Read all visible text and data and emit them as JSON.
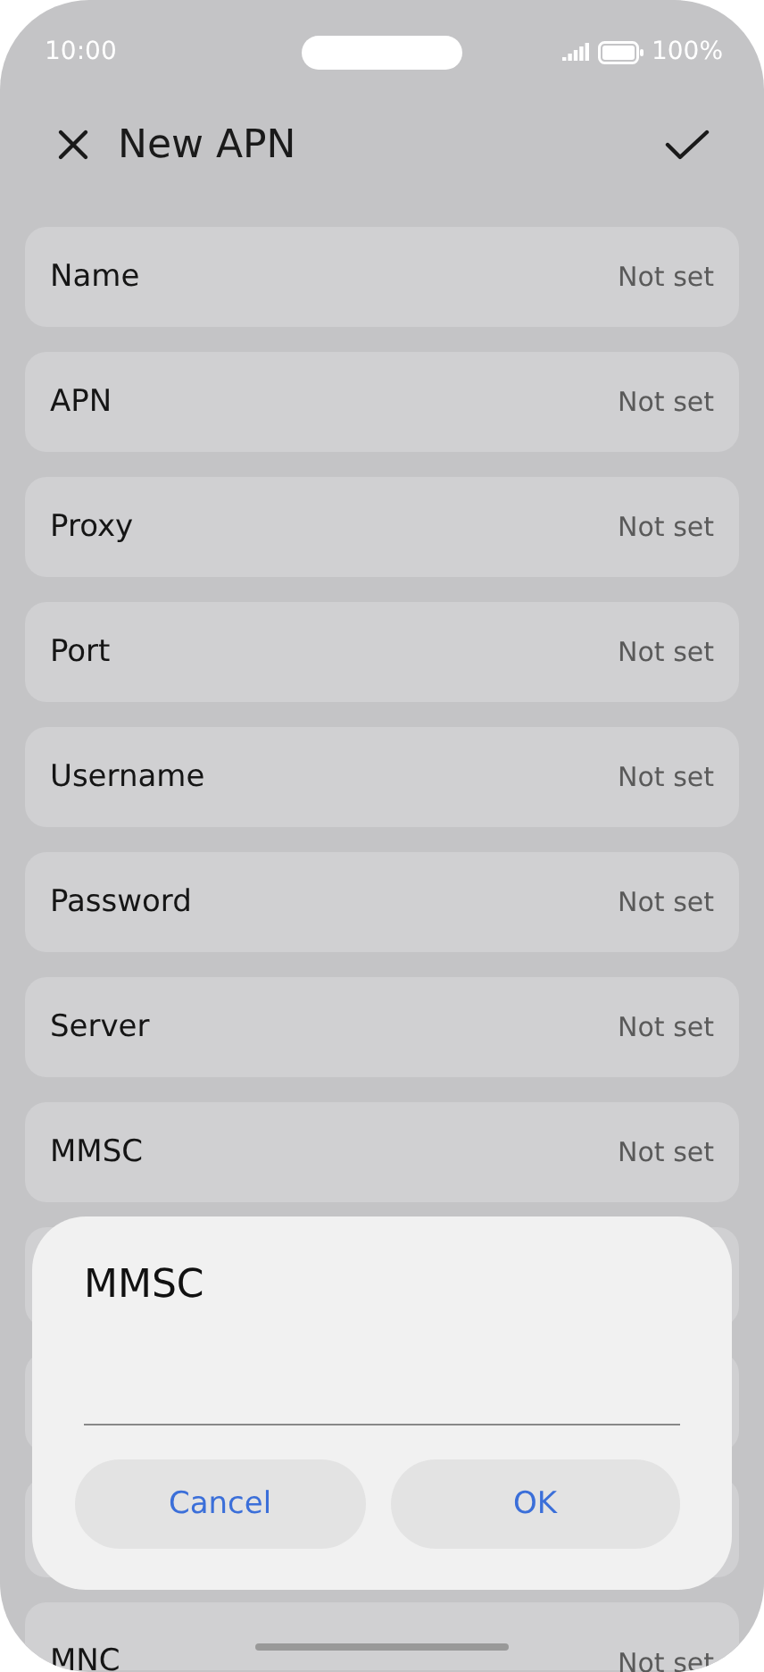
{
  "status_bar": {
    "time": "10:00",
    "battery": "100%"
  },
  "header": {
    "title": "New APN"
  },
  "fields": [
    {
      "label": "Name",
      "value": "Not set"
    },
    {
      "label": "APN",
      "value": "Not set"
    },
    {
      "label": "Proxy",
      "value": "Not set"
    },
    {
      "label": "Port",
      "value": "Not set"
    },
    {
      "label": "Username",
      "value": "Not set"
    },
    {
      "label": "Password",
      "value": "Not set"
    },
    {
      "label": "Server",
      "value": "Not set"
    },
    {
      "label": "MMSC",
      "value": "Not set"
    }
  ],
  "last_field": {
    "label": "MNC",
    "value": "Not set"
  },
  "dialog": {
    "title": "MMSC",
    "buttons": [
      "Cancel",
      "OK"
    ]
  }
}
